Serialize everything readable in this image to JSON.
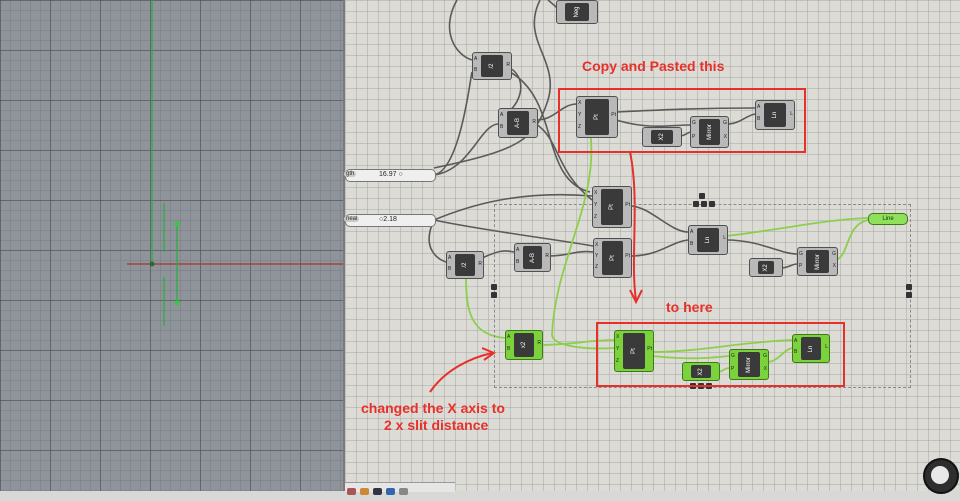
{
  "annotations": {
    "copy": "Copy and Pasted this",
    "to_here": "to here",
    "changed_line1": "changed the X axis to",
    "changed_line2": "2 x slit distance"
  },
  "sliders": [
    {
      "label": "gth",
      "value": "16.97 ○"
    },
    {
      "label": "neal",
      "value": "○2.18"
    }
  ],
  "components": {
    "top_partial": "Neg",
    "div_top": "/2",
    "a_minus_b_top": "A-B",
    "pt_top_copy": "Pt",
    "x2_copy": "X2",
    "mirror_copy": "Mirror",
    "ln_copy": "Ln",
    "pt_mid": "Pt",
    "div_mid": "/2",
    "a_minus_b_mid": "A-B",
    "pt_low": "Pt",
    "ln_mid": "Ln",
    "x2_mid": "X2",
    "mirror_mid": "Mirror",
    "line_out": "Line",
    "x2_green": "x2",
    "pt_green": "Pt",
    "x2_green2": "X2",
    "mirror_green": "Mirror",
    "ln_green": "Ln"
  },
  "colors": {
    "annotation": "#e8302a",
    "wire_default": "#5a5a5a",
    "wire_selected": "#8ccf4d",
    "component_green": "#7bd23c",
    "rhino_axis_x": "#c0392b",
    "rhino_axis_y": "#27ae3e"
  }
}
